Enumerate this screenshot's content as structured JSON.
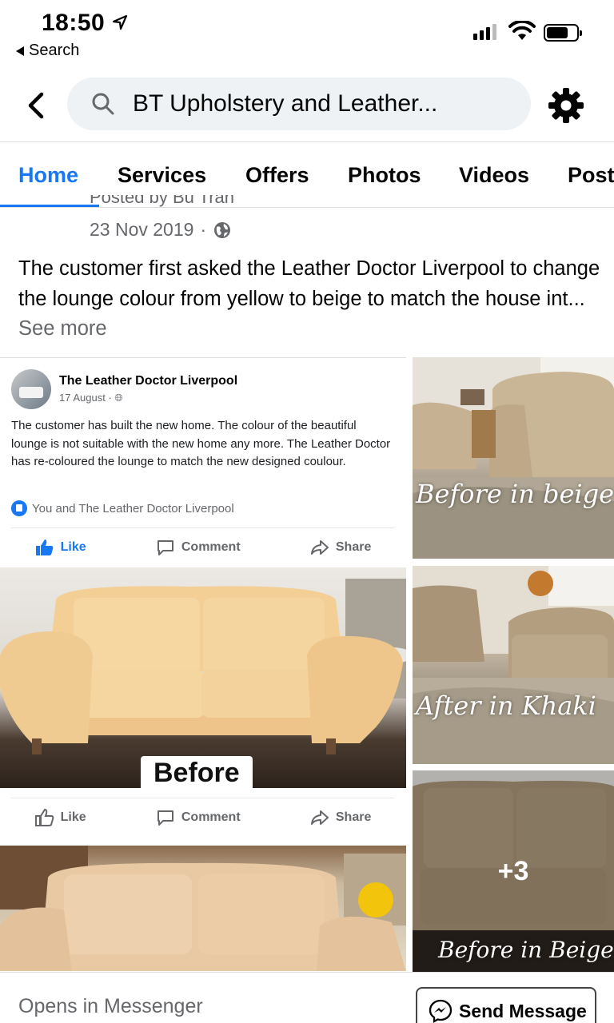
{
  "status_bar": {
    "time": "18:50",
    "back_app": "Search"
  },
  "header": {
    "search_text": "BT Upholstery and Leather..."
  },
  "tabs": [
    {
      "label": "Home"
    },
    {
      "label": "Services"
    },
    {
      "label": "Offers"
    },
    {
      "label": "Photos"
    },
    {
      "label": "Videos"
    },
    {
      "label": "Posts"
    }
  ],
  "post": {
    "posted_by_partial": "Posted by Bu Tran",
    "date": "23 Nov 2019",
    "text": "The customer first asked the Leather Doctor Liverpool to change the lounge colour from yellow to beige to match the house int...",
    "see_more": "See more"
  },
  "embedded_post": {
    "page_name": "The Leather Doctor Liverpool",
    "date": "17 August",
    "text": "The customer has built the new home. The colour of the beautiful lounge is not suitable with the new home any more. The Leather Doctor has re-coloured the lounge to match the new designed coulour.",
    "likes": "You and The Leather Doctor Liverpool",
    "actions": {
      "like": "Like",
      "comment": "Comment",
      "share": "Share"
    },
    "photo_label": "Before"
  },
  "thumbnails": [
    {
      "caption": "Before in beige"
    },
    {
      "caption": "After in Khaki"
    },
    {
      "caption": "Before in Beige",
      "more": "+3"
    }
  ],
  "bottom": {
    "opens": "Opens in Messenger",
    "send": "Send Message"
  },
  "colors": {
    "accent": "#1877f2",
    "text": "#050505",
    "muted": "#65676b"
  }
}
